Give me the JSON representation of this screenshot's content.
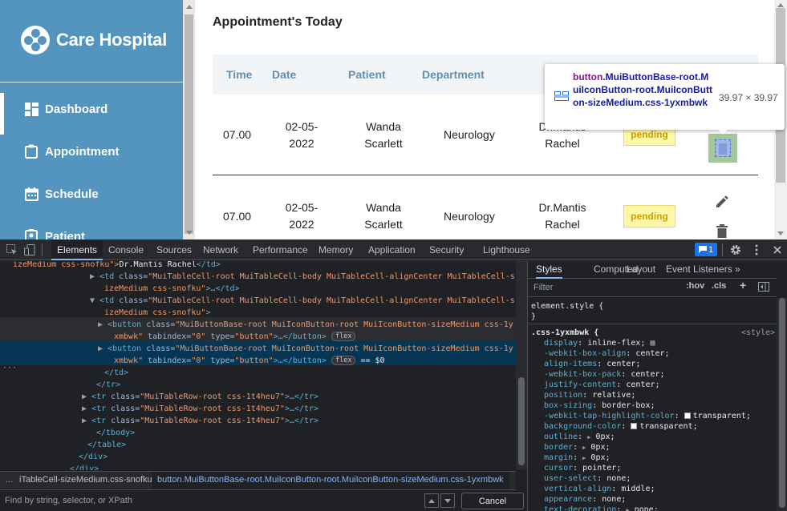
{
  "app": {
    "brand": "Care Hospital",
    "nav": [
      {
        "label": "Dashboard",
        "icon": "dashboard-icon"
      },
      {
        "label": "Appointment",
        "icon": "clipboard-icon"
      },
      {
        "label": "Schedule",
        "icon": "calendar-icon"
      },
      {
        "label": "Patient",
        "icon": "patient-icon"
      }
    ],
    "section_title": "Appointment's Today",
    "columns": [
      "Time",
      "Date",
      "Patient",
      "Department"
    ],
    "rows": [
      {
        "time": "07.00",
        "date_1": "02-05-",
        "date_2": "2022",
        "patient_1": "Wanda",
        "patient_2": "Scarlett",
        "department": "Neurology",
        "doctor_1": "Dr.Mantis",
        "doctor_2": "Rachel",
        "status": "pending"
      },
      {
        "time": "07.00",
        "date_1": "02-05-",
        "date_2": "2022",
        "patient_1": "Wanda",
        "patient_2": "Scarlett",
        "department": "Neurology",
        "doctor_1": "Dr.Mantis",
        "doctor_2": "Rachel",
        "status": "pending"
      }
    ],
    "colors": {
      "sidebar": "#5495bf",
      "badge_bg": "#fff7a8",
      "badge_text": "#c9a400",
      "header_text": "#5f8fb2"
    }
  },
  "tooltip": {
    "selector_tag": "button",
    "selector_classes": ".MuiButtonBase-root.MuiIconButton-root.MuiIconButton-sizeMedium.css-1yxmbwk",
    "dimensions": "39.97 × 39.97"
  },
  "devtools": {
    "tabs": [
      "Elements",
      "Console",
      "Sources",
      "Network",
      "Performance",
      "Memory",
      "Application",
      "Security",
      "Lighthouse"
    ],
    "issues_count": "1",
    "dom_lines": [
      {
        "indent": 16,
        "pre": "izeMedium css-snofku\">",
        "text": "Dr.Mantis Rachel",
        "post": "</td>"
      },
      {
        "indent": 121,
        "tri": "▶",
        "tag": "<td ",
        "attr": "class=",
        "val": "\"MuiTableCell-root MuiTableCell-body MuiTableCell-alignCenter MuiTableCell-s"
      },
      {
        "indent": 130,
        "val": "izeMedium css-snofku\"",
        "post": ">…</td>"
      },
      {
        "indent": 121,
        "tri": "▼",
        "tag": "<td ",
        "attr": "class=",
        "val": "\"MuiTableCell-root MuiTableCell-body MuiTableCell-alignCenter MuiTableCell-s"
      },
      {
        "indent": 130,
        "val": "izeMedium css-snofku\"",
        "post": ">"
      },
      {
        "indent": 131,
        "tri": "▶",
        "tag": "<button ",
        "attr": "class=",
        "val": "\"MuiButtonBase-root MuiIconButton-root MuiIconButton-sizeMedium css-1y"
      },
      {
        "indent": 142,
        "val": "xmbwk\"",
        "attr2": " tabindex=",
        "val2": "\"0\"",
        "attr3": " type=",
        "val3": "\"button\"",
        "post": ">…</button>",
        "badge": "flex"
      },
      {
        "indent": 131,
        "tri": "▶",
        "tag": "<button ",
        "attr": "class=",
        "val": "\"MuiButtonBase-root MuiIconButton-root MuiIconButton-sizeMedium css-1y"
      },
      {
        "indent": 142,
        "val": "xmbwk\"",
        "attr2": " tabindex=",
        "val2": "\"0\"",
        "attr3": " type=",
        "val3": "\"button\"",
        "post": ">…</button>",
        "badge": "flex",
        "eq": "== $0"
      },
      {
        "indent": 130,
        "tag": "</td>"
      },
      {
        "indent": 120,
        "tag": "</tr>"
      },
      {
        "indent": 111,
        "tri": "▶",
        "tag": "<tr ",
        "attr": "class=",
        "val": "\"MuiTableRow-root css-1t4heu7\"",
        "post": ">…</tr>"
      },
      {
        "indent": 111,
        "tri": "▶",
        "tag": "<tr ",
        "attr": "class=",
        "val": "\"MuiTableRow-root css-1t4heu7\"",
        "post": ">…</tr>"
      },
      {
        "indent": 111,
        "tri": "▶",
        "tag": "<tr ",
        "attr": "class=",
        "val": "\"MuiTableRow-root css-1t4heu7\"",
        "post": ">…</tr>"
      },
      {
        "indent": 120,
        "tag": "</tbody>"
      },
      {
        "indent": 109,
        "tag": "</table>"
      },
      {
        "indent": 98,
        "tag": "</div>"
      },
      {
        "indent": 87,
        "tag": "</div>"
      }
    ],
    "breadcrumb": {
      "dots": "...",
      "item1": "iTableCell-sizeMedium.css-snofku",
      "item2": "button.MuiButtonBase-root.MuiIconButton-root.MuiIconButton-sizeMedium.css-1yxmbwk"
    },
    "find_placeholder": "Find by string, selector, or XPath",
    "cancel_label": "Cancel",
    "styles_tabs": [
      "Styles",
      "Computed",
      "Layout",
      "Event Listeners"
    ],
    "styles_more": "»",
    "filter_placeholder": "Filter",
    "hov": ":hov",
    "cls": ".cls",
    "element_style": "element.style {",
    "close_brace": "}",
    "rule_selector": ".css-1yxmbwk {",
    "rule_origin": "<style>",
    "declarations": [
      {
        "p": "display",
        "v": "inline-flex;",
        "grid": true
      },
      {
        "p": "-webkit-box-align",
        "v": "center;"
      },
      {
        "p": "align-items",
        "v": "center;"
      },
      {
        "p": "-webkit-box-pack",
        "v": "center;"
      },
      {
        "p": "justify-content",
        "v": "center;"
      },
      {
        "p": "position",
        "v": "relative;"
      },
      {
        "p": "box-sizing",
        "v": "border-box;"
      },
      {
        "p": "-webkit-tap-highlight-color",
        "v": "transparent;",
        "swatch": true
      },
      {
        "p": "background-color",
        "v": "transparent;",
        "swatch": true
      },
      {
        "p": "outline",
        "v": "0px;",
        "arrow": true
      },
      {
        "p": "border",
        "v": "0px;",
        "arrow": true
      },
      {
        "p": "margin",
        "v": "0px;",
        "arrow": true
      },
      {
        "p": "cursor",
        "v": "pointer;"
      },
      {
        "p": "user-select",
        "v": "none;"
      },
      {
        "p": "vertical-align",
        "v": "middle;"
      },
      {
        "p": "appearance",
        "v": "none;"
      },
      {
        "p": "text-decoration",
        "v": "none;",
        "arrow": true
      }
    ]
  }
}
